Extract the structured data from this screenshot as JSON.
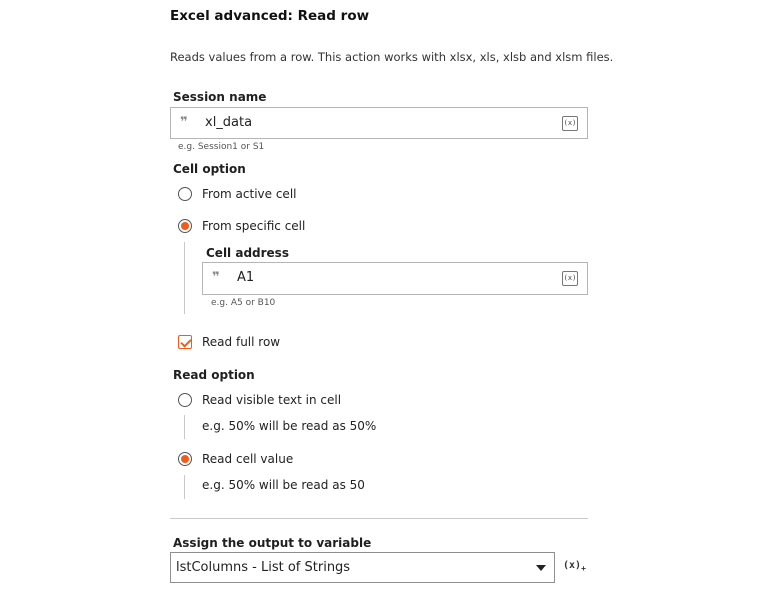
{
  "dialog": {
    "title": "Excel advanced: Read row",
    "description": "Reads values from a row. This action works with xlsx, xls, xlsb and xlsm files."
  },
  "session": {
    "label": "Session name",
    "value": "xl_data",
    "var_icon": "(x)",
    "hint": "e.g. Session1 or S1"
  },
  "cell_option": {
    "label": "Cell option",
    "options": [
      {
        "label": "From active cell",
        "selected": false
      },
      {
        "label": "From specific cell",
        "selected": true
      }
    ],
    "cell_address": {
      "label": "Cell address",
      "value": "A1",
      "var_icon": "(x)",
      "hint": "e.g. A5 or B10"
    }
  },
  "read_full_row": {
    "label": "Read full row",
    "checked": true
  },
  "read_option": {
    "label": "Read option",
    "options": [
      {
        "label": "Read visible text in cell",
        "selected": false,
        "example": "e.g. 50% will be read as 50%"
      },
      {
        "label": "Read cell value",
        "selected": true,
        "example": "e.g. 50% will be read as 50"
      }
    ]
  },
  "output": {
    "label": "Assign the output to variable",
    "value": "lstColumns - List of Strings",
    "add_var_icon": "(x)",
    "add_var_sub": "+"
  },
  "colors": {
    "accent": "#f35b1c"
  },
  "icons": {
    "quote": "quote-icon",
    "variable": "variable-icon",
    "dropdown": "chevron-down-icon",
    "check": "checkmark-icon"
  }
}
